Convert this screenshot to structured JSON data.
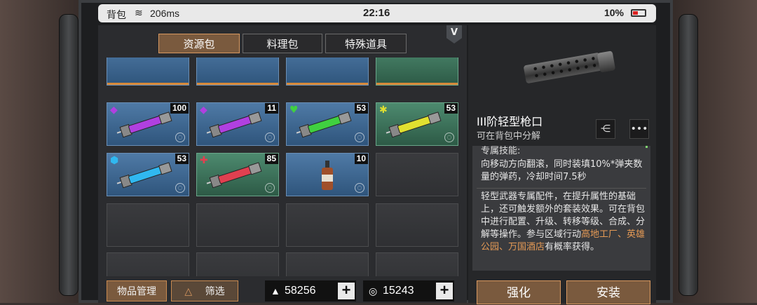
{
  "status": {
    "label": "背包",
    "ping": "206ms",
    "time": "22:16",
    "battery": "10%"
  },
  "tabs": [
    "资源包",
    "料理包",
    "特殊道具"
  ],
  "badge": "V",
  "top_row_count": 4,
  "items": [
    {
      "count": "100",
      "color": "#b040e0",
      "quality": "◆",
      "bg": "blue"
    },
    {
      "count": "11",
      "color": "#b040e0",
      "quality": "◆",
      "bg": "blue"
    },
    {
      "count": "53",
      "color": "#40d040",
      "quality": "♥",
      "bg": "blue"
    },
    {
      "count": "53",
      "color": "#e0e030",
      "quality": "✱",
      "bg": "green"
    },
    {
      "count": "53",
      "color": "#30b8f0",
      "quality": "⬢",
      "bg": "blue"
    },
    {
      "count": "85",
      "color": "#e04050",
      "quality": "✚",
      "bg": "green"
    },
    {
      "count": "10",
      "type": "bottle",
      "bg": "blue"
    }
  ],
  "bottom": {
    "manage": "物品管理",
    "filter": "筛选",
    "currency1": "58256",
    "currency2": "15243"
  },
  "detail": {
    "name": "III阶轻型枪口",
    "sub": "可在背包中分解",
    "desc_cut": "专属技能:",
    "desc1": "向移动方向翻滚，同时装填10%*弹夹数量的弹药，冷却时间7.5秒",
    "desc2_a": "轻型武器专属配件，在提升属性的基础上，还可触发额外的套装效果。可在背包中进行配置、升级、转移等级、合成、分解等操作。参与区域行动",
    "desc2_hl": "高地工厂、英雄公园、万国酒店",
    "desc2_b": "有概率获得。",
    "btn_enhance": "强化",
    "btn_install": "安装"
  },
  "colors": {
    "accent": "#7a5a3e",
    "accent_border": "#d89860",
    "highlight": "#e59a55"
  }
}
